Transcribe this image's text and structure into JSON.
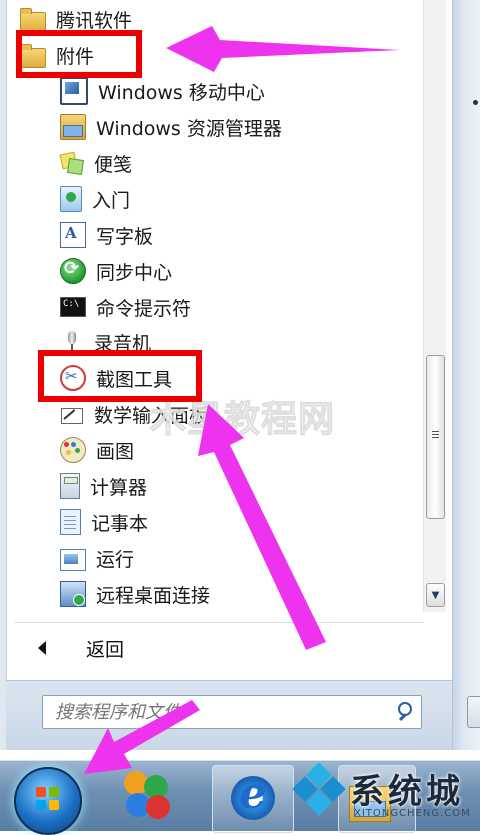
{
  "menu": {
    "folders": [
      {
        "label": "腾讯软件",
        "icon": "folder-icon"
      },
      {
        "label": "附件",
        "icon": "folder-icon"
      }
    ],
    "items": [
      {
        "label": "Windows 移动中心",
        "icon": "mobility-center-icon"
      },
      {
        "label": "Windows 资源管理器",
        "icon": "windows-explorer-icon"
      },
      {
        "label": "便笺",
        "icon": "sticky-notes-icon"
      },
      {
        "label": "入门",
        "icon": "getting-started-icon"
      },
      {
        "label": "写字板",
        "icon": "wordpad-icon"
      },
      {
        "label": "同步中心",
        "icon": "sync-center-icon"
      },
      {
        "label": "命令提示符",
        "icon": "command-prompt-icon"
      },
      {
        "label": "录音机",
        "icon": "sound-recorder-icon"
      },
      {
        "label": "截图工具",
        "icon": "snipping-tool-icon"
      },
      {
        "label": "数学输入面板",
        "icon": "math-input-panel-icon"
      },
      {
        "label": "画图",
        "icon": "paint-icon"
      },
      {
        "label": "计算器",
        "icon": "calculator-icon"
      },
      {
        "label": "记事本",
        "icon": "notepad-icon"
      },
      {
        "label": "运行",
        "icon": "run-icon"
      },
      {
        "label": "远程桌面连接",
        "icon": "remote-desktop-icon"
      }
    ],
    "back_label": "返回"
  },
  "search": {
    "placeholder": "搜索程序和文件"
  },
  "watermark": {
    "center": "木星教程网",
    "logo_text": "系统城",
    "logo_url": "XITONGCHENG.COM"
  },
  "colors": {
    "highlight_box": "#ee0000",
    "arrow": "#ee33ee"
  }
}
